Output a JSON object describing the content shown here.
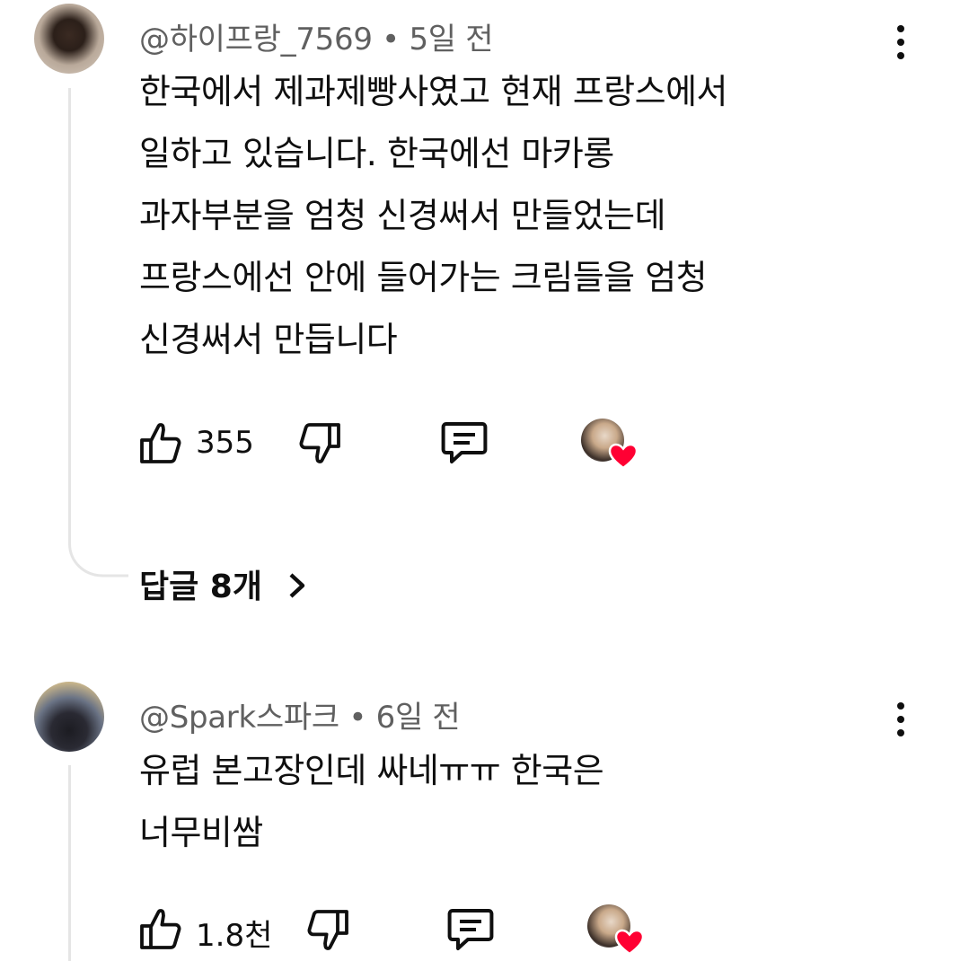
{
  "comments": [
    {
      "author": "@하이프랑_7569",
      "time": "5일 전",
      "lines": [
        "한국에서 제과제빵사였고 현재 프랑스에서",
        "일하고 있습니다. 한국에선 마카롱",
        "과자부분을 엄청 신경써서 만들었는데",
        "프랑스에선 안에 들어가는 크림들을 엄청",
        "신경써서 만듭니다"
      ],
      "likes": "355",
      "replies_label": "답글 8개"
    },
    {
      "author": "@Spark스파크",
      "time": "6일 전",
      "lines": [
        "유럽 본고장인데 싸네ㅠㅠ 한국은",
        "너무비쌈"
      ],
      "likes": "1.8천"
    }
  ],
  "separator": "•",
  "icons": {
    "like": "thumbs-up-icon",
    "dislike": "thumbs-down-icon",
    "reply": "reply-comment-icon",
    "more": "more-vertical-icon",
    "creator_heart": "creator-heart-icon",
    "replies_chevron": "chevron-right-icon"
  },
  "colors": {
    "text": "#0f0f0f",
    "meta": "#606060",
    "heart": "#ff0033"
  }
}
